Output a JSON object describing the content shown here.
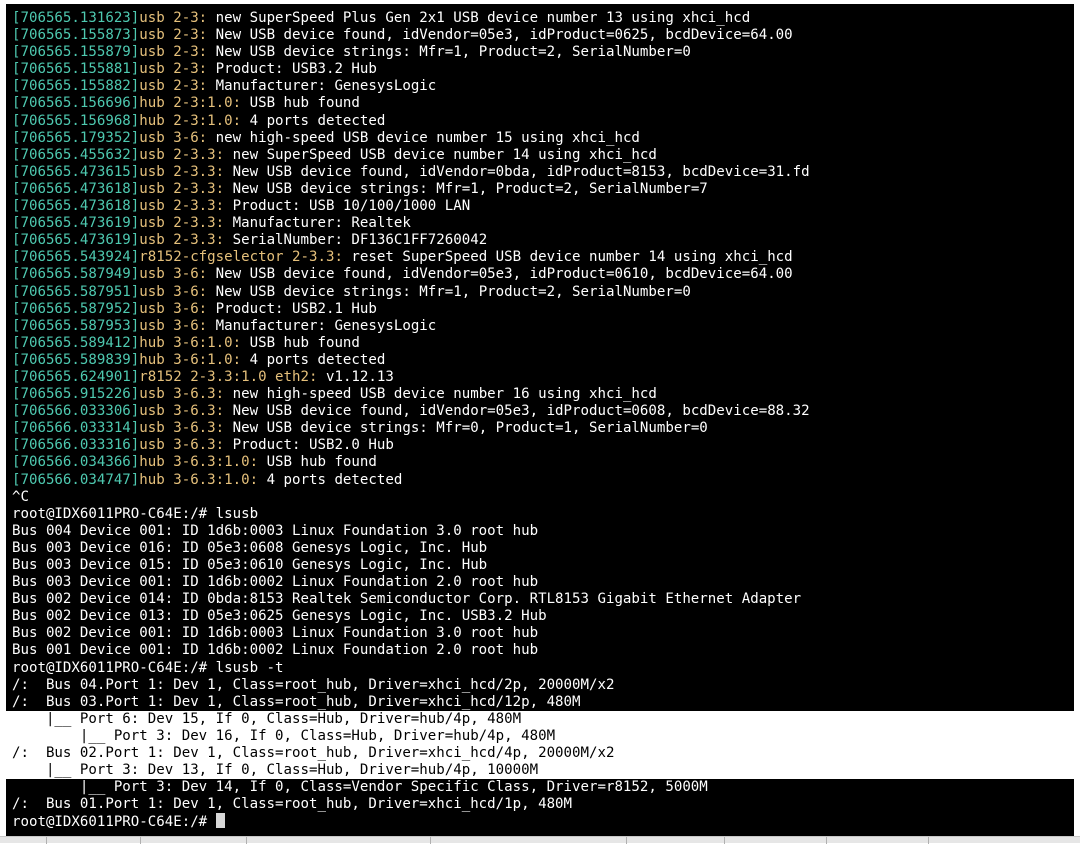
{
  "kernel_log": [
    {
      "ts": "[706565.131623]",
      "src": "usb 2-3:",
      "msg": " new SuperSpeed Plus Gen 2x1 USB device number 13 using xhci_hcd"
    },
    {
      "ts": "[706565.155873]",
      "src": "usb 2-3:",
      "msg": " New USB device found, idVendor=05e3, idProduct=0625, bcdDevice=64.00"
    },
    {
      "ts": "[706565.155879]",
      "src": "usb 2-3:",
      "msg": " New USB device strings: Mfr=1, Product=2, SerialNumber=0"
    },
    {
      "ts": "[706565.155881]",
      "src": "usb 2-3:",
      "msg": " Product: USB3.2 Hub"
    },
    {
      "ts": "[706565.155882]",
      "src": "usb 2-3:",
      "msg": " Manufacturer: GenesysLogic"
    },
    {
      "ts": "[706565.156696]",
      "src": "hub 2-3:1.0:",
      "msg": " USB hub found"
    },
    {
      "ts": "[706565.156968]",
      "src": "hub 2-3:1.0:",
      "msg": " 4 ports detected"
    },
    {
      "ts": "[706565.179352]",
      "src": "usb 3-6:",
      "msg": " new high-speed USB device number 15 using xhci_hcd"
    },
    {
      "ts": "[706565.455632]",
      "src": "usb 2-3.3:",
      "msg": " new SuperSpeed USB device number 14 using xhci_hcd"
    },
    {
      "ts": "[706565.473615]",
      "src": "usb 2-3.3:",
      "msg": " New USB device found, idVendor=0bda, idProduct=8153, bcdDevice=31.fd"
    },
    {
      "ts": "[706565.473618]",
      "src": "usb 2-3.3:",
      "msg": " New USB device strings: Mfr=1, Product=2, SerialNumber=7"
    },
    {
      "ts": "[706565.473618]",
      "src": "usb 2-3.3:",
      "msg": " Product: USB 10/100/1000 LAN"
    },
    {
      "ts": "[706565.473619]",
      "src": "usb 2-3.3:",
      "msg": " Manufacturer: Realtek"
    },
    {
      "ts": "[706565.473619]",
      "src": "usb 2-3.3:",
      "msg": " SerialNumber: DF136C1FF7260042"
    },
    {
      "ts": "[706565.543924]",
      "src": "r8152-cfgselector 2-3.3:",
      "msg": " reset SuperSpeed USB device number 14 using xhci_hcd"
    },
    {
      "ts": "[706565.587949]",
      "src": "usb 3-6:",
      "msg": " New USB device found, idVendor=05e3, idProduct=0610, bcdDevice=64.00"
    },
    {
      "ts": "[706565.587951]",
      "src": "usb 3-6:",
      "msg": " New USB device strings: Mfr=1, Product=2, SerialNumber=0"
    },
    {
      "ts": "[706565.587952]",
      "src": "usb 3-6:",
      "msg": " Product: USB2.1 Hub"
    },
    {
      "ts": "[706565.587953]",
      "src": "usb 3-6:",
      "msg": " Manufacturer: GenesysLogic"
    },
    {
      "ts": "[706565.589412]",
      "src": "hub 3-6:1.0:",
      "msg": " USB hub found"
    },
    {
      "ts": "[706565.589839]",
      "src": "hub 3-6:1.0:",
      "msg": " 4 ports detected"
    },
    {
      "ts": "[706565.624901]",
      "src": "r8152 2-3.3:1.0 eth2:",
      "msg": " v1.12.13"
    },
    {
      "ts": "[706565.915226]",
      "src": "usb 3-6.3:",
      "msg": " new high-speed USB device number 16 using xhci_hcd"
    },
    {
      "ts": "[706566.033306]",
      "src": "usb 3-6.3:",
      "msg": " New USB device found, idVendor=05e3, idProduct=0608, bcdDevice=88.32"
    },
    {
      "ts": "[706566.033314]",
      "src": "usb 3-6.3:",
      "msg": " New USB device strings: Mfr=0, Product=1, SerialNumber=0"
    },
    {
      "ts": "[706566.033316]",
      "src": "usb 3-6.3:",
      "msg": " Product: USB2.0 Hub"
    },
    {
      "ts": "[706566.034366]",
      "src": "hub 3-6.3:1.0:",
      "msg": " USB hub found"
    },
    {
      "ts": "[706566.034747]",
      "src": "hub 3-6.3:1.0:",
      "msg": " 4 ports detected"
    }
  ],
  "interrupt": "^C",
  "prompt1": "root@IDX6011PRO-C64E:/# lsusb",
  "lsusb_output": [
    "Bus 004 Device 001: ID 1d6b:0003 Linux Foundation 3.0 root hub",
    "Bus 003 Device 016: ID 05e3:0608 Genesys Logic, Inc. Hub",
    "Bus 003 Device 015: ID 05e3:0610 Genesys Logic, Inc. Hub",
    "Bus 003 Device 001: ID 1d6b:0002 Linux Foundation 2.0 root hub",
    "Bus 002 Device 014: ID 0bda:8153 Realtek Semiconductor Corp. RTL8153 Gigabit Ethernet Adapter",
    "Bus 002 Device 013: ID 05e3:0625 Genesys Logic, Inc. USB3.2 Hub",
    "Bus 002 Device 001: ID 1d6b:0003 Linux Foundation 3.0 root hub",
    "Bus 001 Device 001: ID 1d6b:0002 Linux Foundation 2.0 root hub"
  ],
  "prompt2": "root@IDX6011PRO-C64E:/# lsusb -t",
  "tree_output": [
    {
      "text": "/:  Bus 04.Port 1: Dev 1, Class=root_hub, Driver=xhci_hcd/2p, 20000M/x2",
      "hl": false
    },
    {
      "text": "/:  Bus 03.Port 1: Dev 1, Class=root_hub, Driver=xhci_hcd/12p, 480M",
      "hl": false
    },
    {
      "text": "    |__ Port 6: Dev 15, If 0, Class=Hub, Driver=hub/4p, 480M",
      "hl": true
    },
    {
      "text": "        |__ Port 3: Dev 16, If 0, Class=Hub, Driver=hub/4p, 480M",
      "hl": true
    },
    {
      "text": "/:  Bus 02.Port 1: Dev 1, Class=root_hub, Driver=xhci_hcd/4p, 20000M/x2",
      "hl": true
    },
    {
      "text": "    |__ Port 3: Dev 13, If 0, Class=Hub, Driver=hub/4p, 10000M",
      "hl": true
    },
    {
      "text": "        |__ Port 3: Dev 14, If 0, Class=Vendor Specific Class, Driver=r8152, 5000M",
      "hl": false
    },
    {
      "text": "/:  Bus 01.Port 1: Dev 1, Class=root_hub, Driver=xhci_hcd/1p, 480M",
      "hl": false
    }
  ],
  "prompt3": "root@IDX6011PRO-C64E:/# ",
  "colors": {
    "background": "#000000",
    "timestamp": "#4ec9b0",
    "source": "#e5c07b",
    "text": "#ffffff",
    "selection": "#ffffff"
  }
}
